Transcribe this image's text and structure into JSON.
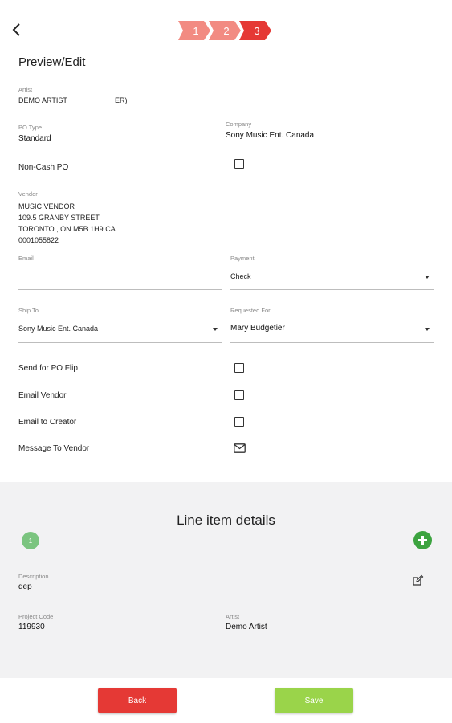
{
  "header": {
    "steps": [
      "1",
      "2",
      "3"
    ],
    "colors": {
      "inactive": "#f28b82",
      "active": "#e53935"
    }
  },
  "page_title": "Preview/Edit",
  "artist": {
    "label": "Artist",
    "value": "DEMO ARTIST",
    "suffix": "ER)"
  },
  "po_type": {
    "label": "PO Type",
    "value": "Standard"
  },
  "company": {
    "label": "Company",
    "value": "Sony Music Ent. Canada"
  },
  "non_cash": {
    "label": "Non-Cash PO",
    "checked": false
  },
  "vendor": {
    "label": "Vendor",
    "lines": [
      "MUSIC VENDOR",
      "109.5 GRANBY STREET",
      "TORONTO , ON M5B 1H9 CA",
      "0001055822"
    ]
  },
  "email": {
    "label": "Email",
    "value": ""
  },
  "payment": {
    "label": "Payment",
    "value": "Check"
  },
  "ship_to": {
    "label": "Ship To",
    "value": "Sony Music Ent. Canada"
  },
  "requested_for": {
    "label": "Requested For",
    "value": "Mary Budgetier"
  },
  "options": {
    "send_po_flip": "Send for PO Flip",
    "email_vendor": "Email Vendor",
    "email_creator": "Email to Creator",
    "message_vendor": "Message To Vendor"
  },
  "line_items": {
    "title": "Line item details",
    "badge": "1",
    "description": {
      "label": "Description",
      "value": "dep"
    },
    "project_code": {
      "label": "Project Code",
      "value": "119930"
    },
    "artist": {
      "label": "Artist",
      "value": "Demo Artist"
    }
  },
  "footer": {
    "back": "Back",
    "save": "Save"
  }
}
